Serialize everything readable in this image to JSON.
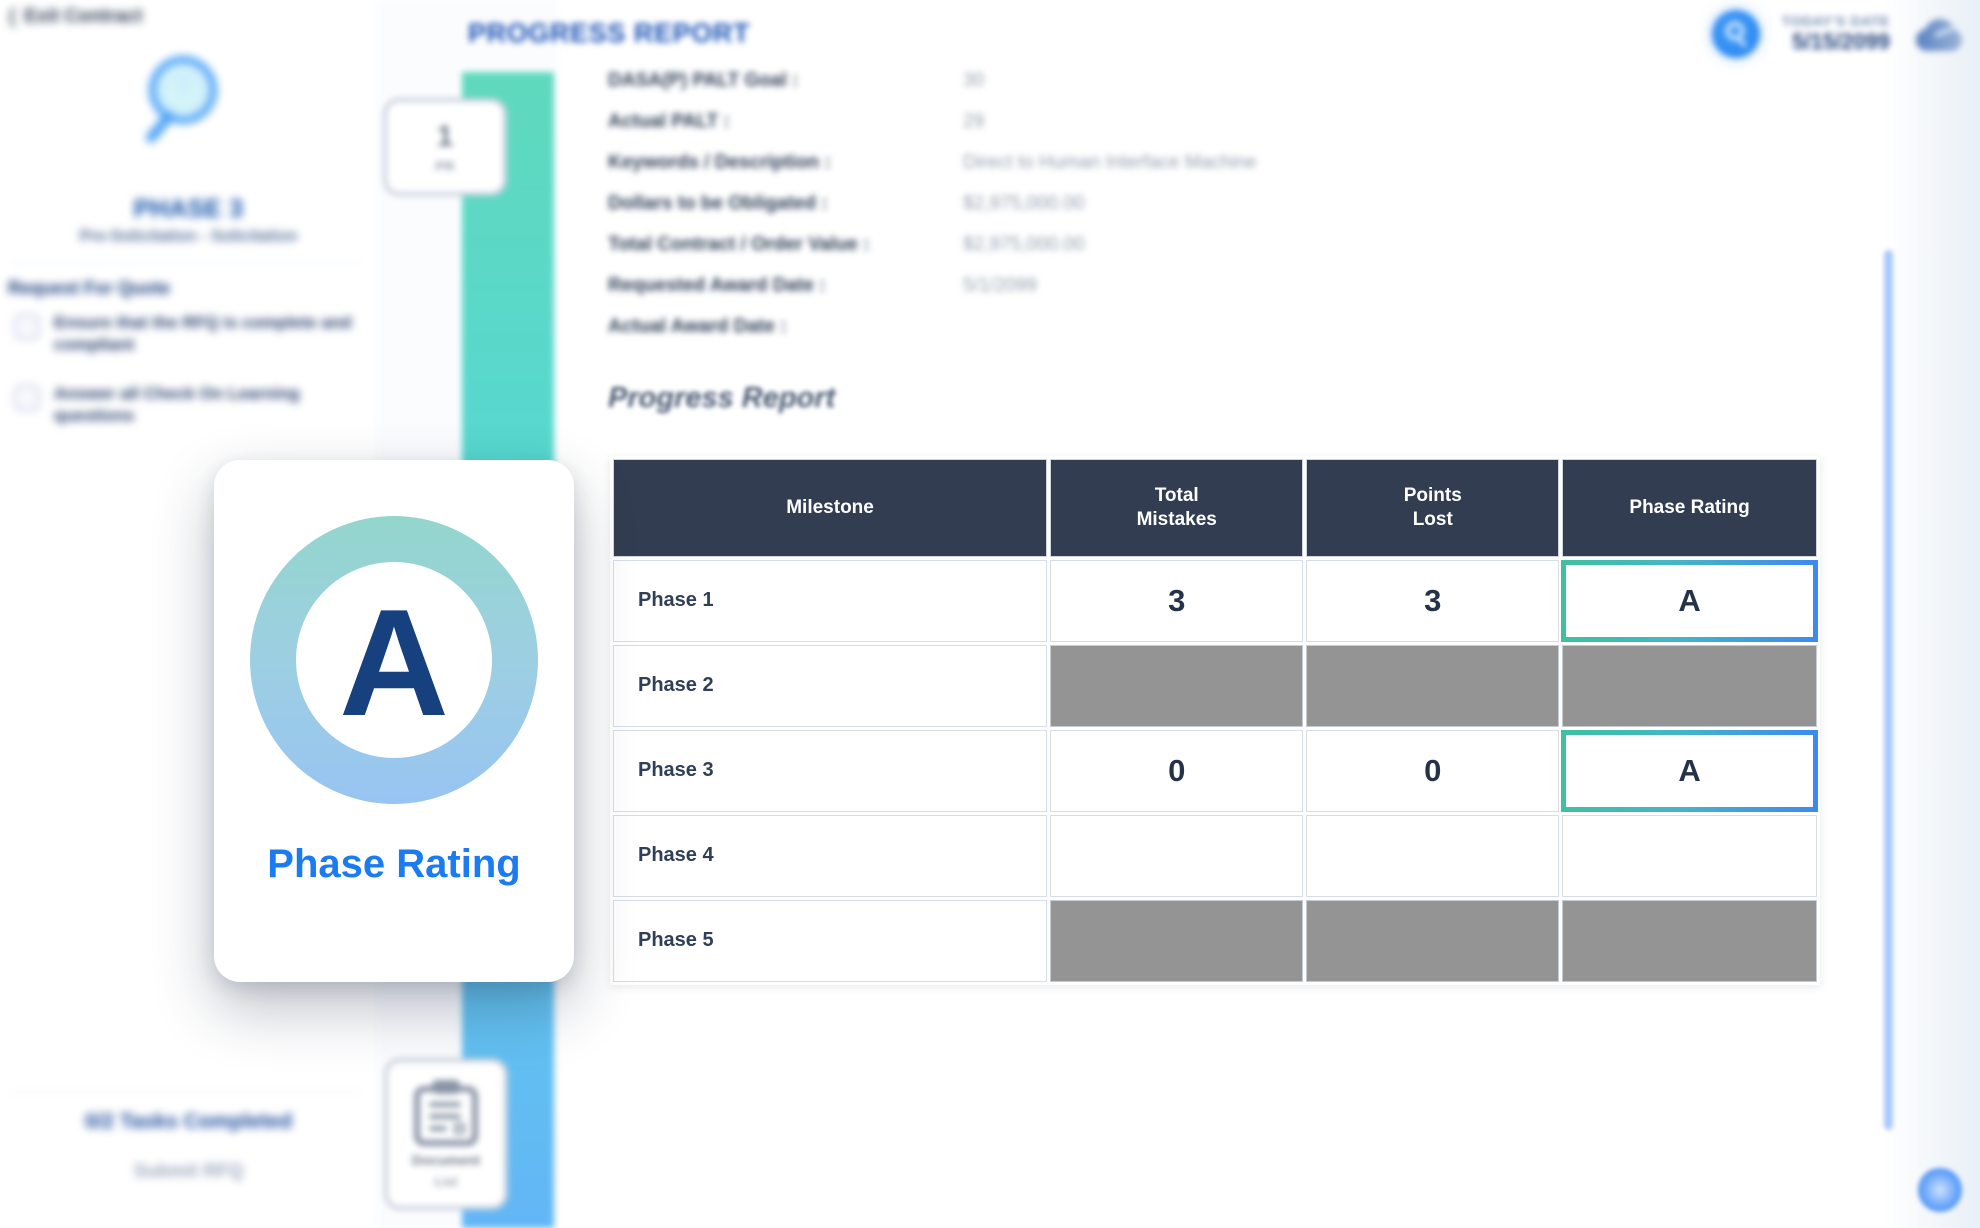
{
  "sidebar": {
    "back_label": "Exit Contract",
    "phase_icon": "magnifier-icon",
    "phase_title": "PHASE 3",
    "phase_subtitle": "Pre-Solicitation - Solicitation",
    "section_heading": "Request For Quote",
    "tasks": [
      {
        "label": "Ensure that the RFQ is complete and compliant",
        "checked": false
      },
      {
        "label": "Answer all Check On Learning questions",
        "checked": false
      }
    ],
    "tasks_completed": "0/2 Tasks Completed",
    "submit_label": "Submit RFQ"
  },
  "timeline": {
    "node_number": "1",
    "node_label": "PR",
    "doc_label": "Document",
    "doc_sublabel": "List"
  },
  "header": {
    "title": "PROGRESS REPORT",
    "search_icon": "search-icon",
    "date_label": "TODAY'S DATE",
    "date_value": "5/15/2099",
    "cloud_icon": "cloud-icon"
  },
  "details": {
    "fields": [
      {
        "label": "DASA(P) PALT Goal :",
        "value": "30"
      },
      {
        "label": "Actual PALT :",
        "value": "29"
      },
      {
        "label": "Keywords / Description :",
        "value": "Direct to Human Interface Machine"
      },
      {
        "label": "Dollars to be Obligated :",
        "value": "$2,975,000.00"
      },
      {
        "label": "Total Contract / Order Value :",
        "value": "$2,975,000.00"
      },
      {
        "label": "Requested Award Date :",
        "value": "5/1/2099"
      },
      {
        "label": "Actual Award Date :",
        "value": ""
      }
    ]
  },
  "progress_section": {
    "subtitle": "Progress Report",
    "table": {
      "columns": [
        "Milestone",
        "Total\nMistakes",
        "Points\nLost",
        "Phase Rating"
      ],
      "column_labels": {
        "milestone": "Milestone",
        "mistakes_line1": "Total",
        "mistakes_line2": "Mistakes",
        "points_line1": "Points",
        "points_line2": "Lost",
        "rating": "Phase Rating"
      },
      "rows": [
        {
          "milestone": "Phase 1",
          "total_mistakes": "3",
          "points_lost": "3",
          "phase_rating": "A",
          "state": "complete",
          "rating_highlighted": true
        },
        {
          "milestone": "Phase 2",
          "total_mistakes": "",
          "points_lost": "",
          "phase_rating": "",
          "state": "disabled",
          "rating_highlighted": false
        },
        {
          "milestone": "Phase 3",
          "total_mistakes": "0",
          "points_lost": "0",
          "phase_rating": "A",
          "state": "complete",
          "rating_highlighted": true
        },
        {
          "milestone": "Phase 4",
          "total_mistakes": "",
          "points_lost": "",
          "phase_rating": "",
          "state": "empty",
          "rating_highlighted": false
        },
        {
          "milestone": "Phase 5",
          "total_mistakes": "",
          "points_lost": "",
          "phase_rating": "",
          "state": "disabled",
          "rating_highlighted": false
        }
      ]
    }
  },
  "rating_card": {
    "grade": "A",
    "label": "Phase Rating"
  },
  "colors": {
    "table_header": "#323d51",
    "disabled_cell": "#949494",
    "highlight_gradient_start": "#3fc0a0",
    "highlight_gradient_end": "#3d89f0",
    "accent_blue": "#1a7cf0",
    "grade_navy": "#17407f",
    "title_blue": "#1a52b6"
  }
}
